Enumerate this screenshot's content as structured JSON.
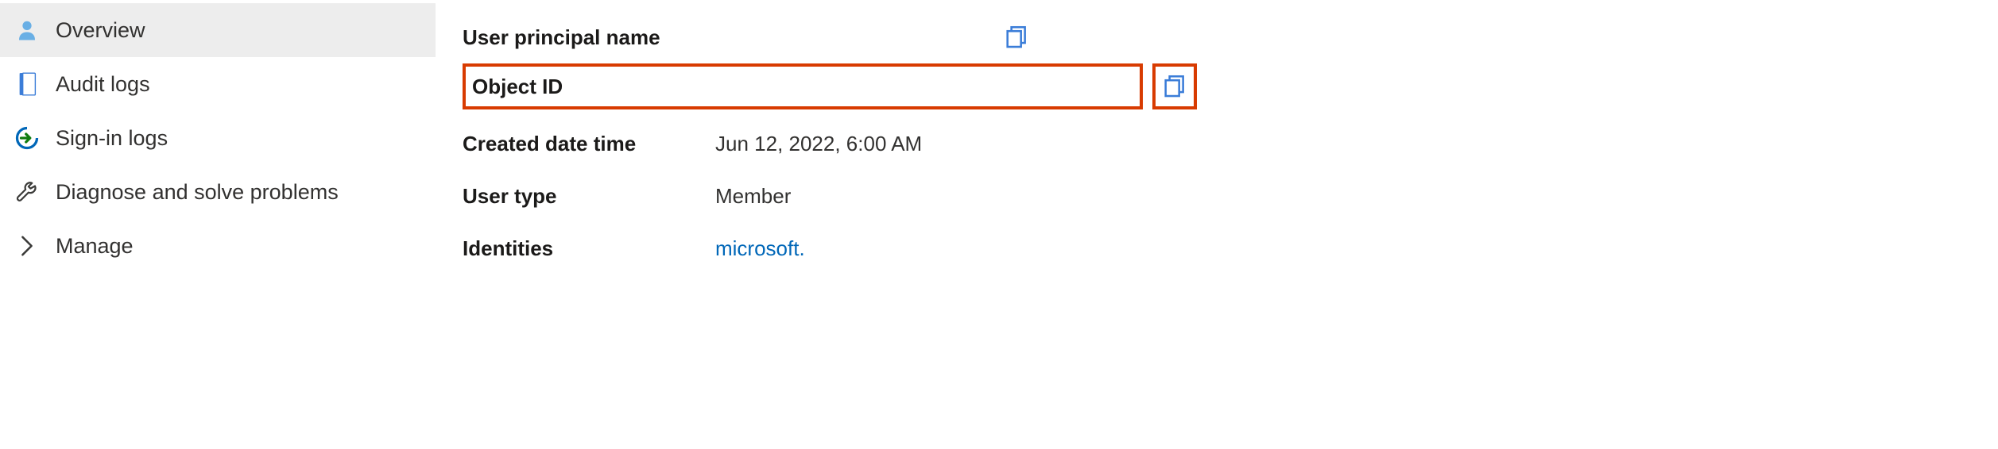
{
  "sidebar": {
    "items": [
      {
        "label": "Overview"
      },
      {
        "label": "Audit logs"
      },
      {
        "label": "Sign-in logs"
      },
      {
        "label": "Diagnose and solve problems"
      },
      {
        "label": "Manage"
      }
    ]
  },
  "properties": {
    "userPrincipalName": {
      "label": "User principal name",
      "value": ""
    },
    "objectId": {
      "label": "Object ID",
      "value": ""
    },
    "createdDateTime": {
      "label": "Created date time",
      "value": "Jun 12, 2022, 6:00 AM"
    },
    "userType": {
      "label": "User type",
      "value": "Member"
    },
    "identities": {
      "label": "Identities",
      "value": "microsoft."
    }
  },
  "colors": {
    "highlight": "#d83b01",
    "link": "#0067b8"
  }
}
